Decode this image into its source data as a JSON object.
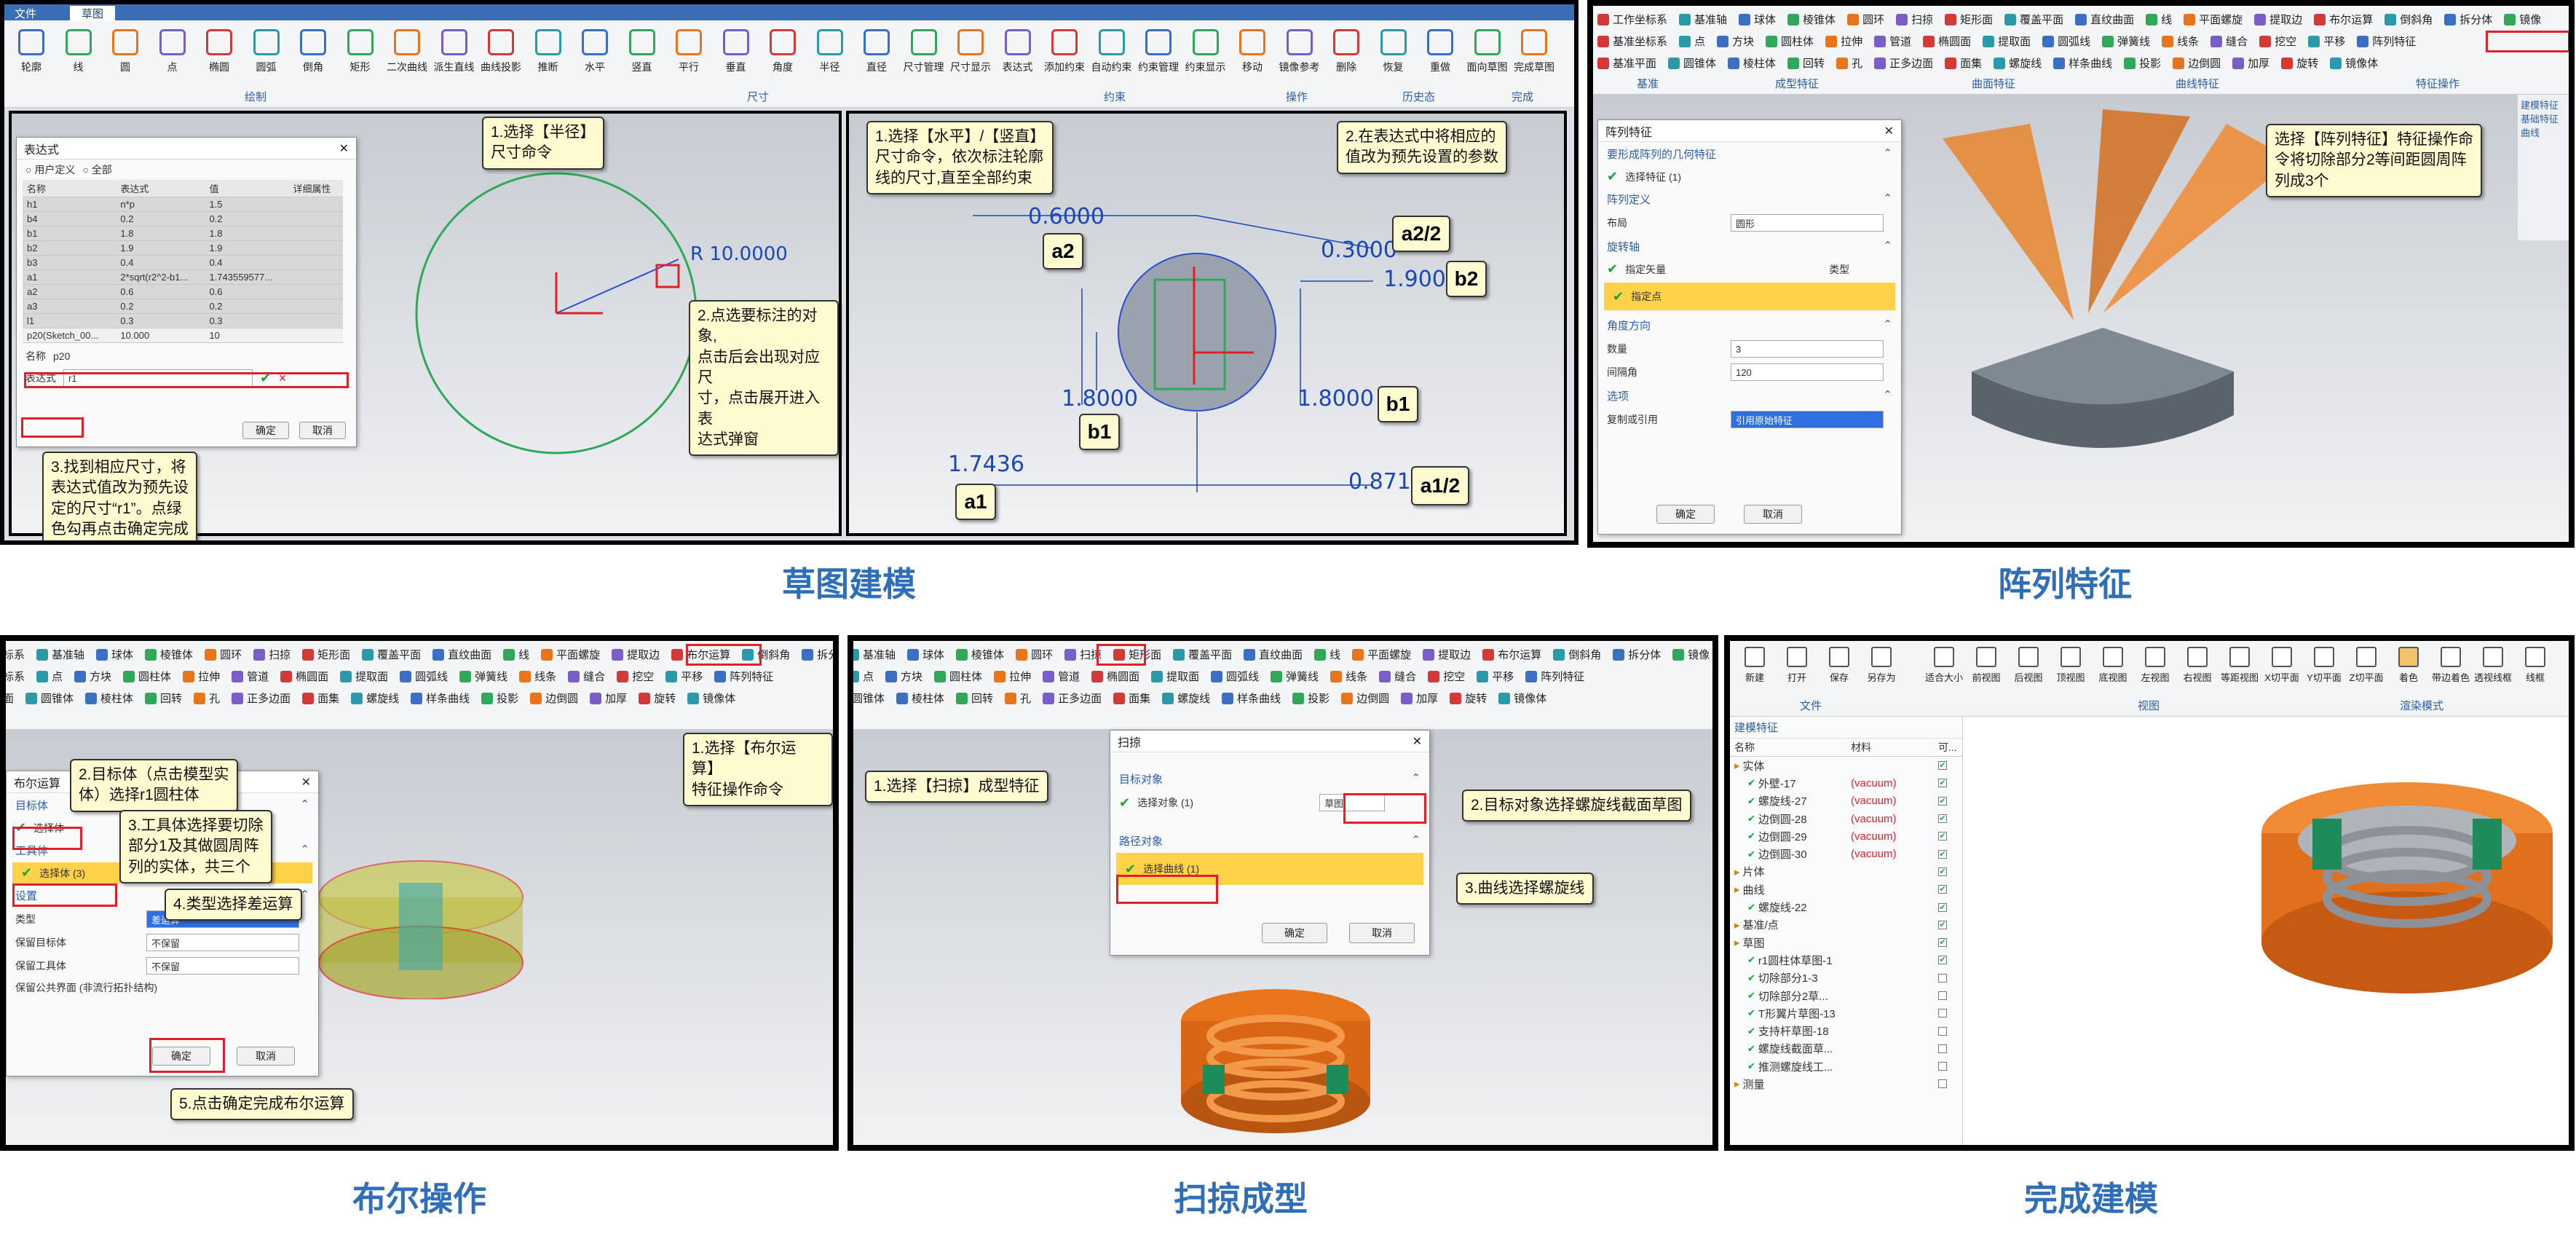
{
  "captions": [
    "草图建模",
    "阵列特征",
    "布尔操作",
    "扫掠成型",
    "完成建模"
  ],
  "main_ribbon": {
    "tabs": [
      "文件",
      "草图"
    ],
    "tools": [
      "轮廓",
      "线",
      "圆",
      "点",
      "椭圆",
      "圆弧",
      "倒角",
      "矩形",
      "二次曲线",
      "派生直线",
      "曲线投影",
      "推断",
      "水平",
      "竖直",
      "平行",
      "垂直",
      "角度",
      "半径",
      "直径",
      "尺寸管理",
      "尺寸显示",
      "表达式",
      "添加约束",
      "自动约束",
      "约束管理",
      "约束显示",
      "移动",
      "镜像参考",
      "删除",
      "恢复",
      "重做",
      "面向草图",
      "完成草图"
    ],
    "groups": [
      "绘制",
      "尺寸",
      "约束",
      "操作",
      "历史态",
      "完成"
    ]
  },
  "top_ribbon": {
    "row1": [
      "工作坐标系",
      "基准轴",
      "球体",
      "棱锥体",
      "圆环",
      "扫掠",
      "矩形面",
      "覆盖平面",
      "直纹曲面",
      "线",
      "平面螺旋",
      "提取边",
      "布尔运算",
      "倒斜角",
      "拆分体",
      "镜像"
    ],
    "row2": [
      "基准坐标系",
      "点",
      "方块",
      "圆柱体",
      "拉伸",
      "管道",
      "椭圆面",
      "提取面",
      "圆弧线",
      "弹簧线",
      "线条",
      "缝合",
      "挖空",
      "平移",
      "阵列特征"
    ],
    "row3": [
      "基准平面",
      "圆锥体",
      "棱柱体",
      "回转",
      "孔",
      "正多边面",
      "面集",
      "螺旋线",
      "样条曲线",
      "投影",
      "边倒圆",
      "加厚",
      "旋转",
      "镜像体"
    ],
    "groups": [
      "基准",
      "成型特征",
      "曲面特征",
      "曲线特征",
      "特征操作"
    ]
  },
  "file_ribbon": {
    "tools": [
      "新建",
      "打开",
      "保存",
      "另存为",
      "适合大小",
      "前视图",
      "后视图",
      "顶视图",
      "底视图",
      "左视图",
      "右视图",
      "等距视图",
      "X切平面",
      "Y切平面",
      "Z切平面",
      "着色",
      "带边着色",
      "透视线框",
      "线框"
    ],
    "groups": [
      "文件",
      "视图",
      "渲染模式"
    ]
  },
  "expr_dialog": {
    "title": "表达式",
    "filter": [
      "用户定义",
      "全部"
    ],
    "headers": [
      "名称",
      "表达式",
      "值",
      "详细属性"
    ],
    "rows": [
      [
        "h1",
        "n*p",
        "1.5"
      ],
      [
        "b4",
        "0.2",
        "0.2"
      ],
      [
        "b1",
        "1.8",
        "1.8"
      ],
      [
        "b2",
        "1.9",
        "1.9"
      ],
      [
        "b3",
        "0.4",
        "0.4"
      ],
      [
        "a1",
        "2*sqrt(r2^2-b1...",
        "1.743559577..."
      ],
      [
        "a2",
        "0.6",
        "0.6"
      ],
      [
        "a3",
        "0.2",
        "0.2"
      ],
      [
        "l1",
        "0.3",
        "0.3"
      ],
      [
        "p20(Sketch_00...",
        "10.000",
        "10"
      ]
    ],
    "name_label": "名称",
    "name_value": "p20",
    "expr_label": "表达式",
    "expr_value": "r1",
    "ok": "确定",
    "cancel": "取消"
  },
  "radius_dim": "R 10.0000",
  "sketch_notes": {
    "n1": "1.选择【半径】\n尺寸命令",
    "n2": "2.点选要标注的对象,\n点击后会出现对应尺\n寸，点击展开进入表\n达式弹窗",
    "n3": "3.找到相应尺寸，将\n表达式值改为预先设\n定的尺寸“r1”。点绿\n色勾再点击确定完成"
  },
  "dims_notes": {
    "n1": "1.选择【水平】/【竖直】\n尺寸命令，依次标注轮廓\n线的尺寸,直至全部约束",
    "n2": "2.在表达式中将相应的\n值改为预先设置的参数"
  },
  "dims": {
    "top_left": "0.6000",
    "top_right": "0.3000",
    "right": "1.9000",
    "left_mid": "1.8000",
    "right_mid": "1.8000",
    "bottom_left": "1.7436",
    "bottom_right": "0.8718"
  },
  "dim_tags": [
    "a2",
    "a2/2",
    "b2",
    "b1",
    "b1",
    "a1",
    "a1/2"
  ],
  "array_dialog": {
    "title": "阵列特征",
    "s1": "要形成阵列的几何特征",
    "pick1": "选择特征 (1)",
    "s2": "阵列定义",
    "layout_label": "布局",
    "layout_value": "圆形",
    "s3": "旋转轴",
    "vec": "指定矢量",
    "vec_type": "类型",
    "pt": "指定点",
    "s4": "角度方向",
    "count_label": "数量",
    "count_value": "3",
    "pitch_label": "间隔角",
    "pitch_value": "120",
    "s5": "选项",
    "copy_label": "复制或引用",
    "copy_value": "引用原始特征",
    "ok": "确定",
    "cancel": "取消"
  },
  "array_note": "选择【阵列特征】特征操作命\n令将切除部分2等间距圆周阵\n列成3个",
  "array_side": [
    "建模特征",
    "基础特征",
    "曲线"
  ],
  "bool_dialog": {
    "title": "布尔运算",
    "target": "目标体",
    "pick_target": "选择体",
    "tool": "工具体",
    "pick_tool": "选择体 (3)",
    "settings": "设置",
    "type_label": "类型",
    "type_value": "差运算",
    "keep_target": "保留目标体",
    "keep_tool": "保留工具体",
    "keep_value": "不保留",
    "merge": "保留公共界面 (非流行拓扑结构)",
    "ok": "确定",
    "cancel": "取消"
  },
  "bool_notes": {
    "n1": "1.选择【布尔运算】\n特征操作命令",
    "n2": "2.目标体（点击模型实\n体）选择r1圆柱体",
    "n3": "3.工具体选择要切除\n部分1及其做圆周阵\n列的实体，共三个",
    "n4": "4.类型选择差运算",
    "n5": "5.点击确定完成布尔运算"
  },
  "sweep_dialog": {
    "title": "扫掠",
    "target": "目标对象",
    "pick_target": "选择对象 (1)",
    "type_value": "草图",
    "path": "路径对象",
    "pick_path": "选择曲线 (1)",
    "ok": "确定",
    "cancel": "取消"
  },
  "sweep_notes": {
    "n1": "1.选择【扫掠】成型特征",
    "n2": "2.目标对象选择螺旋线截面草图",
    "n3": "3.曲线选择螺旋线"
  },
  "tree": {
    "title": "建模特征",
    "headers": [
      "名称",
      "材料",
      "可..."
    ],
    "items": [
      {
        "t": "实体",
        "lvl": 0,
        "m": ""
      },
      {
        "t": "外壁-17",
        "lvl": 1,
        "m": "(vacuum)"
      },
      {
        "t": "螺旋线-27",
        "lvl": 1,
        "m": "(vacuum)"
      },
      {
        "t": "边倒圆-28",
        "lvl": 1,
        "m": "(vacuum)"
      },
      {
        "t": "边倒圆-29",
        "lvl": 1,
        "m": "(vacuum)"
      },
      {
        "t": "边倒圆-30",
        "lvl": 1,
        "m": "(vacuum)"
      },
      {
        "t": "片体",
        "lvl": 0,
        "m": ""
      },
      {
        "t": "曲线",
        "lvl": 0,
        "m": ""
      },
      {
        "t": "螺旋线-22",
        "lvl": 1,
        "m": ""
      },
      {
        "t": "基准/点",
        "lvl": 0,
        "m": ""
      },
      {
        "t": "草图",
        "lvl": 0,
        "m": ""
      },
      {
        "t": "r1圆柱体草图-1",
        "lvl": 1,
        "m": ""
      },
      {
        "t": "切除部分1-3",
        "lvl": 1,
        "m": ""
      },
      {
        "t": "切除部分2草...",
        "lvl": 1,
        "m": ""
      },
      {
        "t": "T形翼片草图-13",
        "lvl": 1,
        "m": ""
      },
      {
        "t": "支持杆草图-18",
        "lvl": 1,
        "m": ""
      },
      {
        "t": "螺旋线截面草...",
        "lvl": 1,
        "m": ""
      },
      {
        "t": "推测螺旋线工...",
        "lvl": 1,
        "m": ""
      },
      {
        "t": "测量",
        "lvl": 0,
        "m": ""
      }
    ]
  },
  "colors": {
    "accent": "#2f6fb9",
    "highlight": "#ffd24a",
    "red": "#e0202a",
    "copper": "#e8741c"
  }
}
